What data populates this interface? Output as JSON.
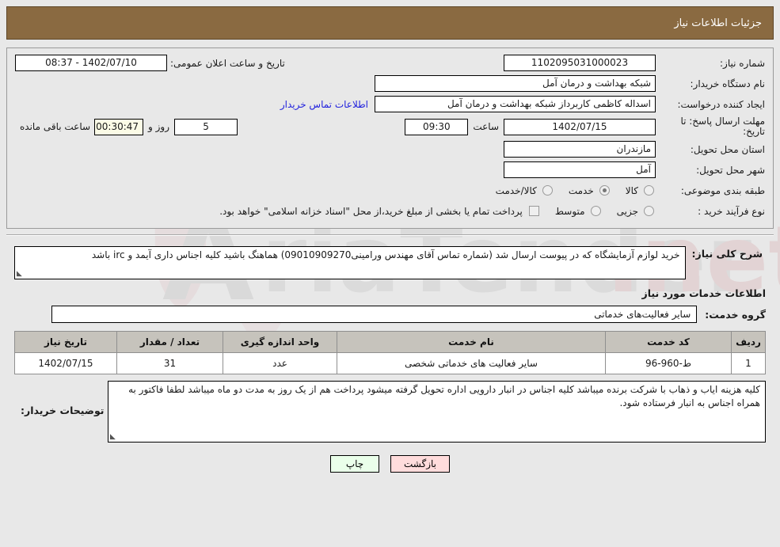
{
  "header": {
    "title": "جزئیات اطلاعات نیاز"
  },
  "info": {
    "need_no_label": "شماره نیاز:",
    "need_no_value": "1102095031000023",
    "announce_label": "تاریخ و ساعت اعلان عمومی:",
    "announce_value": "1402/07/10 - 08:37",
    "org_label": "نام دستگاه خریدار:",
    "org_value": "شبکه بهداشت و درمان آمل",
    "creator_label": "ایجاد کننده درخواست:",
    "creator_value": "اسداله کاظمی کاربرداز شبکه بهداشت و درمان آمل",
    "contact_link": "اطلاعات تماس خریدار",
    "deadline_label": "مهلت ارسال پاسخ: تا تاریخ:",
    "deadline_date": "1402/07/15",
    "hour_label": "ساعت",
    "deadline_time": "09:30",
    "days_value": "5",
    "days_label": "روز و",
    "remaining_value": "00:30:47",
    "remaining_label": "ساعت باقی مانده",
    "province_label": "استان محل تحویل:",
    "province_value": "مازندران",
    "city_label": "شهر محل تحویل:",
    "city_value": "آمل",
    "category_label": "طبقه بندی موضوعی:",
    "category_options": [
      {
        "label": "کالا",
        "selected": false
      },
      {
        "label": "خدمت",
        "selected": true
      },
      {
        "label": "کالا/خدمت",
        "selected": false
      }
    ],
    "process_label": "نوع فرآیند خرید :",
    "process_options": [
      {
        "label": "جزیی",
        "selected": false
      },
      {
        "label": "متوسط",
        "selected": false
      }
    ],
    "treasury_checkbox_text": "پرداخت تمام یا بخشی از مبلغ خرید،از محل \"اسناد خزانه اسلامی\" خواهد بود.",
    "treasury_checked": false
  },
  "description": {
    "label": "شرح کلی نیاز:",
    "value": "خرید لوازم آزمایشگاه که در پیوست ارسال شد (شماره تماس آقای مهندس ورامینی09010909270) هماهنگ باشید کلیه اجناس داری آیمد و irc باشد"
  },
  "services_section": {
    "heading": "اطلاعات خدمات مورد نیاز",
    "group_label": "گروه خدمت:",
    "group_value": "سایر فعالیت‌های خدماتی"
  },
  "table": {
    "columns": [
      "ردیف",
      "کد خدمت",
      "نام خدمت",
      "واحد اندازه گیری",
      "تعداد / مقدار",
      "تاریخ نیاز"
    ],
    "rows": [
      {
        "radif": "1",
        "code": "ط-960-96",
        "name": "سایر فعالیت های خدماتی شخصی",
        "unit": "عدد",
        "qty": "31",
        "date": "1402/07/15"
      }
    ]
  },
  "buyer_notes": {
    "label": "توضیحات خریدار:",
    "value": "کلیه هزینه ایاب و ذهاب با شرکت برنده میباشد کلیه اجناس در انبار دارویی اداره تحویل گرفته میشود پرداخت هم از یک روز به مدت دو ماه میباشد لطفا فاکتور به همراه اجناس به انبار فرستاده شود."
  },
  "buttons": {
    "print": "چاپ",
    "back": "بازگشت"
  },
  "watermark": {
    "text": "AriaTender.net"
  },
  "colors": {
    "header_bg": "#8a6a41",
    "page_bg": "#e8e8e8",
    "link": "#2222dd",
    "table_header_bg": "#c6c3bc",
    "print_btn_bg": "#eaffea",
    "back_btn_bg": "#ffdcdc",
    "remaining_bg": "#fbfbe6"
  }
}
